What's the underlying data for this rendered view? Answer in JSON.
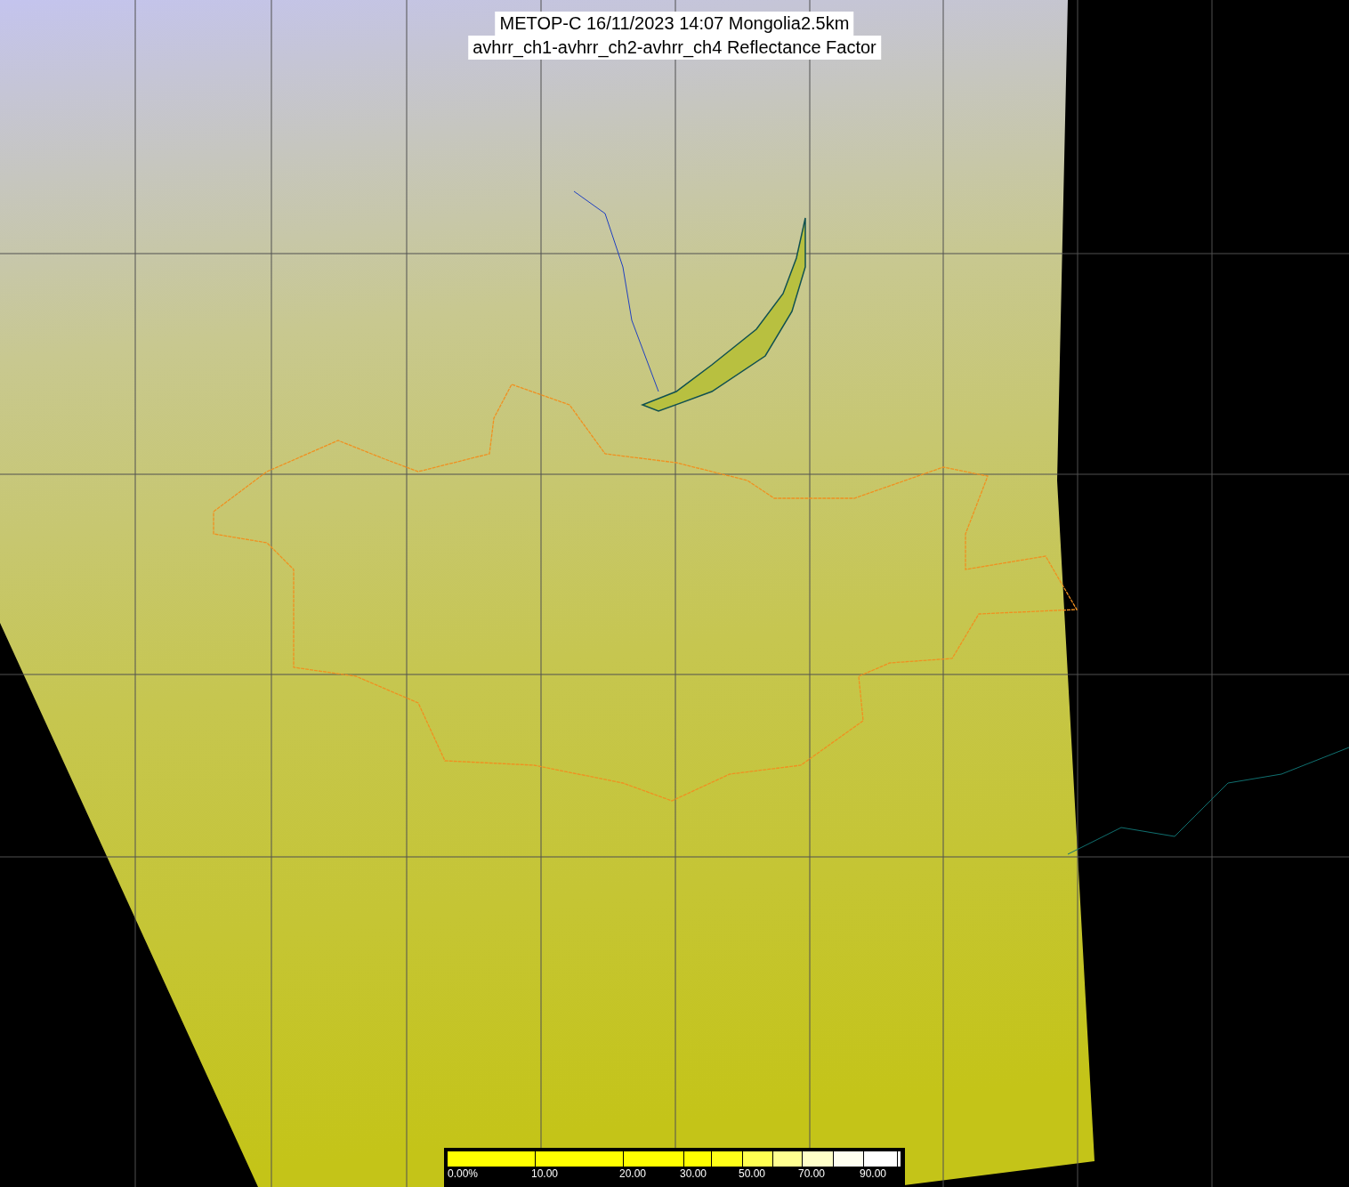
{
  "title": {
    "lines": [
      "METOP-C 16/11/2023 14:07 Mongolia2.5km",
      "avhrr_ch1-avhrr_ch2-avhrr_ch4 Reflectance Factor"
    ]
  },
  "legend": {
    "segments": [
      {
        "color": "#ffff00",
        "label": "0.00%"
      },
      {
        "color": "#ffff00",
        "label": "10.00"
      },
      {
        "color": "#ffff00",
        "label": "20.00"
      },
      {
        "color": "#ffff00",
        "label": "30.00"
      },
      {
        "color": "#ffff18"
      },
      {
        "color": "#ffff50",
        "label": "50.00"
      },
      {
        "color": "#ffff90"
      },
      {
        "color": "#ffffc8",
        "label": "70.00"
      },
      {
        "color": "#fffff0"
      },
      {
        "color": "#ffffff",
        "label": "90.00"
      },
      {
        "color": "#ffffff"
      }
    ]
  }
}
